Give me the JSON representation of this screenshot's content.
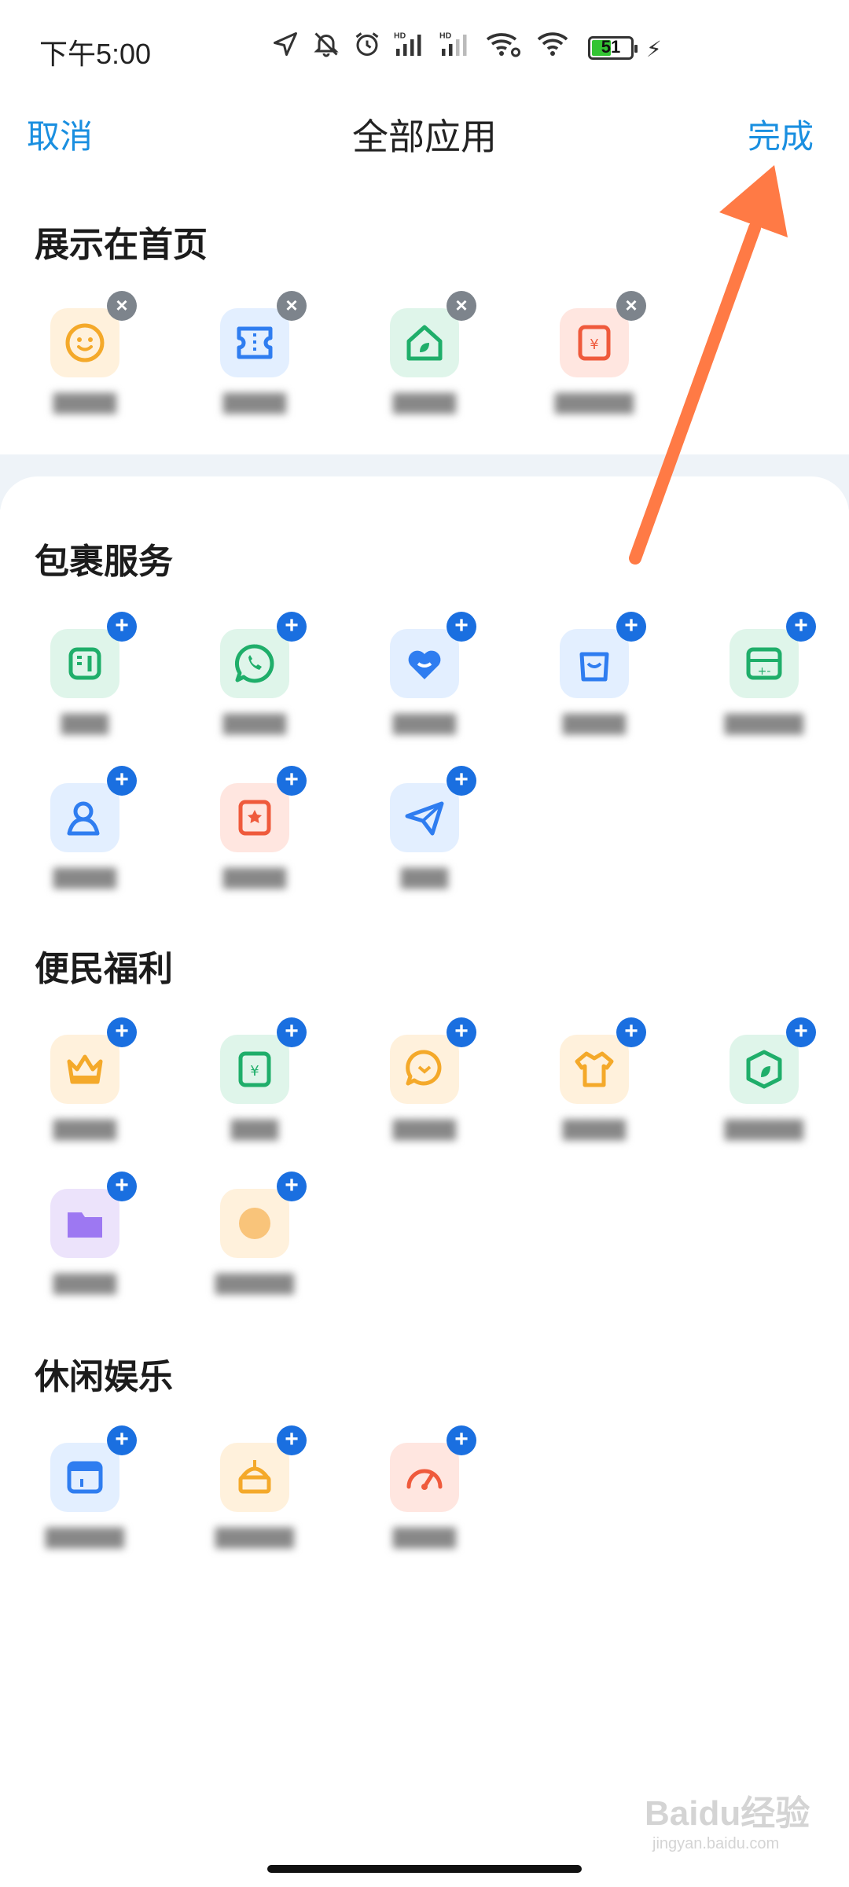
{
  "status": {
    "time": "下午5:00",
    "battery": "51",
    "battery_level": 0.51,
    "hd1": "HD",
    "hd2": "HD"
  },
  "header": {
    "cancel": "取消",
    "title": "全部应用",
    "done": "完成"
  },
  "sections": {
    "home": {
      "title": "展示在首页"
    },
    "package": {
      "title": "包裹服务"
    },
    "welfare": {
      "title": "便民福利"
    },
    "leisure": {
      "title": "休闲娱乐"
    }
  },
  "colors": {
    "accent": "#1a8fe0",
    "add_badge": "#1a6fe0",
    "remove_badge": "#7d848c",
    "arrow": "#ff7a45"
  },
  "watermark": {
    "brand": "Baidu经验",
    "url": "jingyan.baidu.com"
  }
}
